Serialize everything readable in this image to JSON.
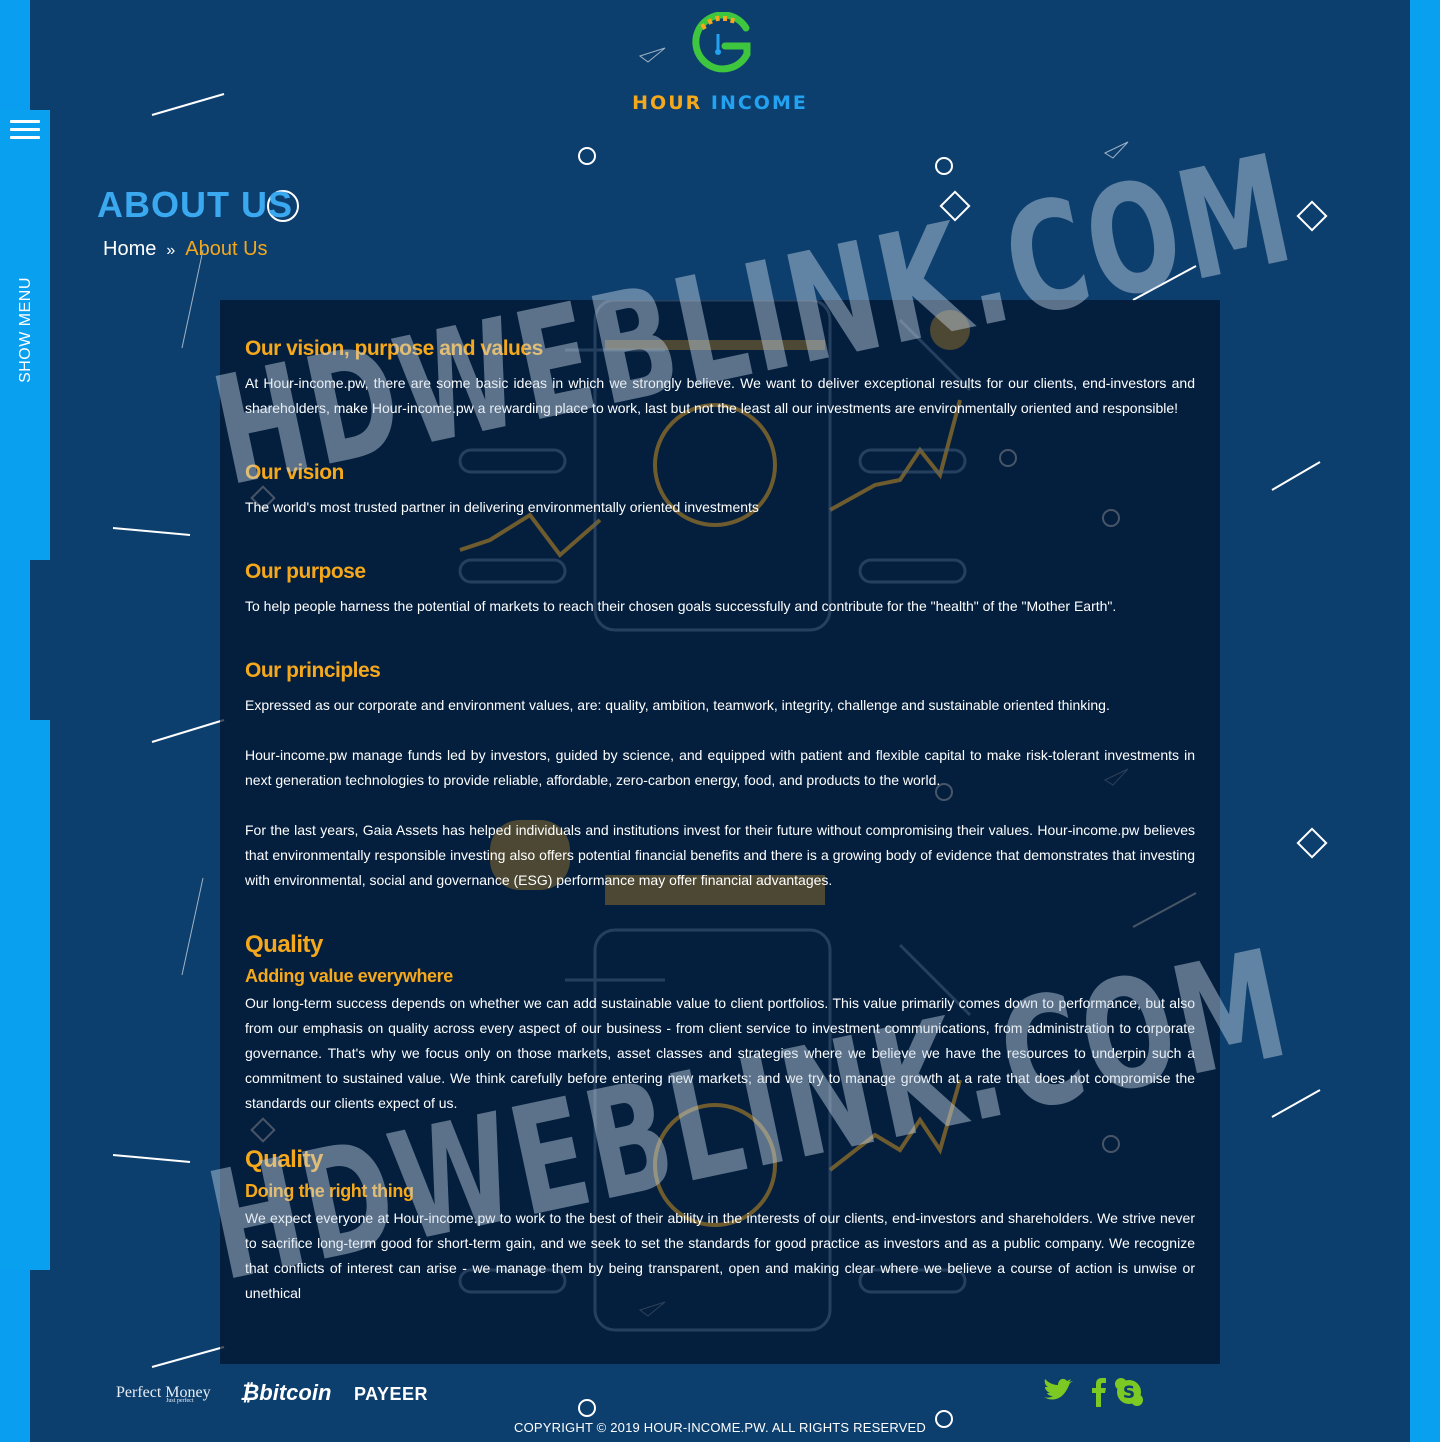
{
  "brand": {
    "name_part1": "HOUR",
    "name_part2": "INCOME",
    "colors": {
      "orange": "#f5a81c",
      "blue": "#22a2f0",
      "green": "#3ec63e",
      "background": "#0d3f6e"
    }
  },
  "side_menu": {
    "label": "SHOW MENU",
    "icon": "hamburger-icon"
  },
  "page": {
    "title": "ABOUT US",
    "breadcrumb": {
      "home": "Home",
      "separator": "»",
      "current": "About Us"
    }
  },
  "content": {
    "s1": {
      "heading": "Our vision, purpose and values",
      "text": "At Hour-income.pw, there are some basic ideas in which we strongly believe. We want to deliver exceptional results for our clients, end-investors and shareholders, make Hour-income.pw a rewarding place to work, last but not the least all our investments are environmentally oriented and responsible!"
    },
    "s2": {
      "heading": "Our vision",
      "text": "The world's most trusted partner in delivering environmentally oriented investments"
    },
    "s3": {
      "heading": "Our purpose",
      "text": "To help people harness the potential of markets to reach their chosen goals successfully and contribute for the \"health\" of the \"Mother Earth\"."
    },
    "s4": {
      "heading": "Our principles",
      "p1": "Expressed as our corporate and environment values, are: quality, ambition, teamwork, integrity, challenge and sustainable oriented thinking.",
      "p2": "Hour-income.pw manage funds led by investors, guided by science, and equipped with patient and flexible capital to make risk-tolerant investments in next generation technologies to provide reliable, affordable, zero-carbon energy, food, and products to the world.",
      "p3": "For the last years, Gaia Assets has helped individuals and institutions invest for their future without compromising their values. Hour-income.pw believes that environmentally responsible investing also offers potential financial benefits and there is a growing body of evidence that demonstrates that investing with environmental, social and governance (ESG) performance may offer financial advantages."
    },
    "s5": {
      "heading": "Quality",
      "subheading": "Adding value everywhere",
      "text": "Our long-term success depends on whether we can add sustainable value to client portfolios. This value primarily comes down to performance, but also from our emphasis on quality across every aspect of our business - from client service to investment communications, from administration to corporate governance. That's why we focus only on those markets, asset classes and strategies where we believe we have the resources to underpin such a commitment to sustained value. We think carefully before entering new markets; and we try to manage growth at a rate that does not compromise the standards our clients expect of us."
    },
    "s6": {
      "heading": "Quality",
      "subheading": "Doing the right thing",
      "text": "We expect everyone at Hour-income.pw to work to the best of their ability in the interests of our clients, end-investors and shareholders. We strive never to sacrifice long-term good for short-term gain, and we seek to set the standards for good practice as investors and as a public company. We recognize that conflicts of interest can arise - we manage them by being transparent, open and making clear where we believe a course of action is unwise or unethical"
    }
  },
  "footer": {
    "payments": {
      "perfect_money": "Perfect Money",
      "perfect_money_tag": "Just perfect",
      "bitcoin": "bitcoin",
      "payeer": "PAYEER"
    },
    "social": [
      "twitter-icon",
      "facebook-icon",
      "skype-icon"
    ],
    "copyright": "COPYRIGHT © 2019 HOUR-INCOME.PW. ALL RIGHTS RESERVED"
  },
  "watermark": "HDWEBLINK.COM"
}
